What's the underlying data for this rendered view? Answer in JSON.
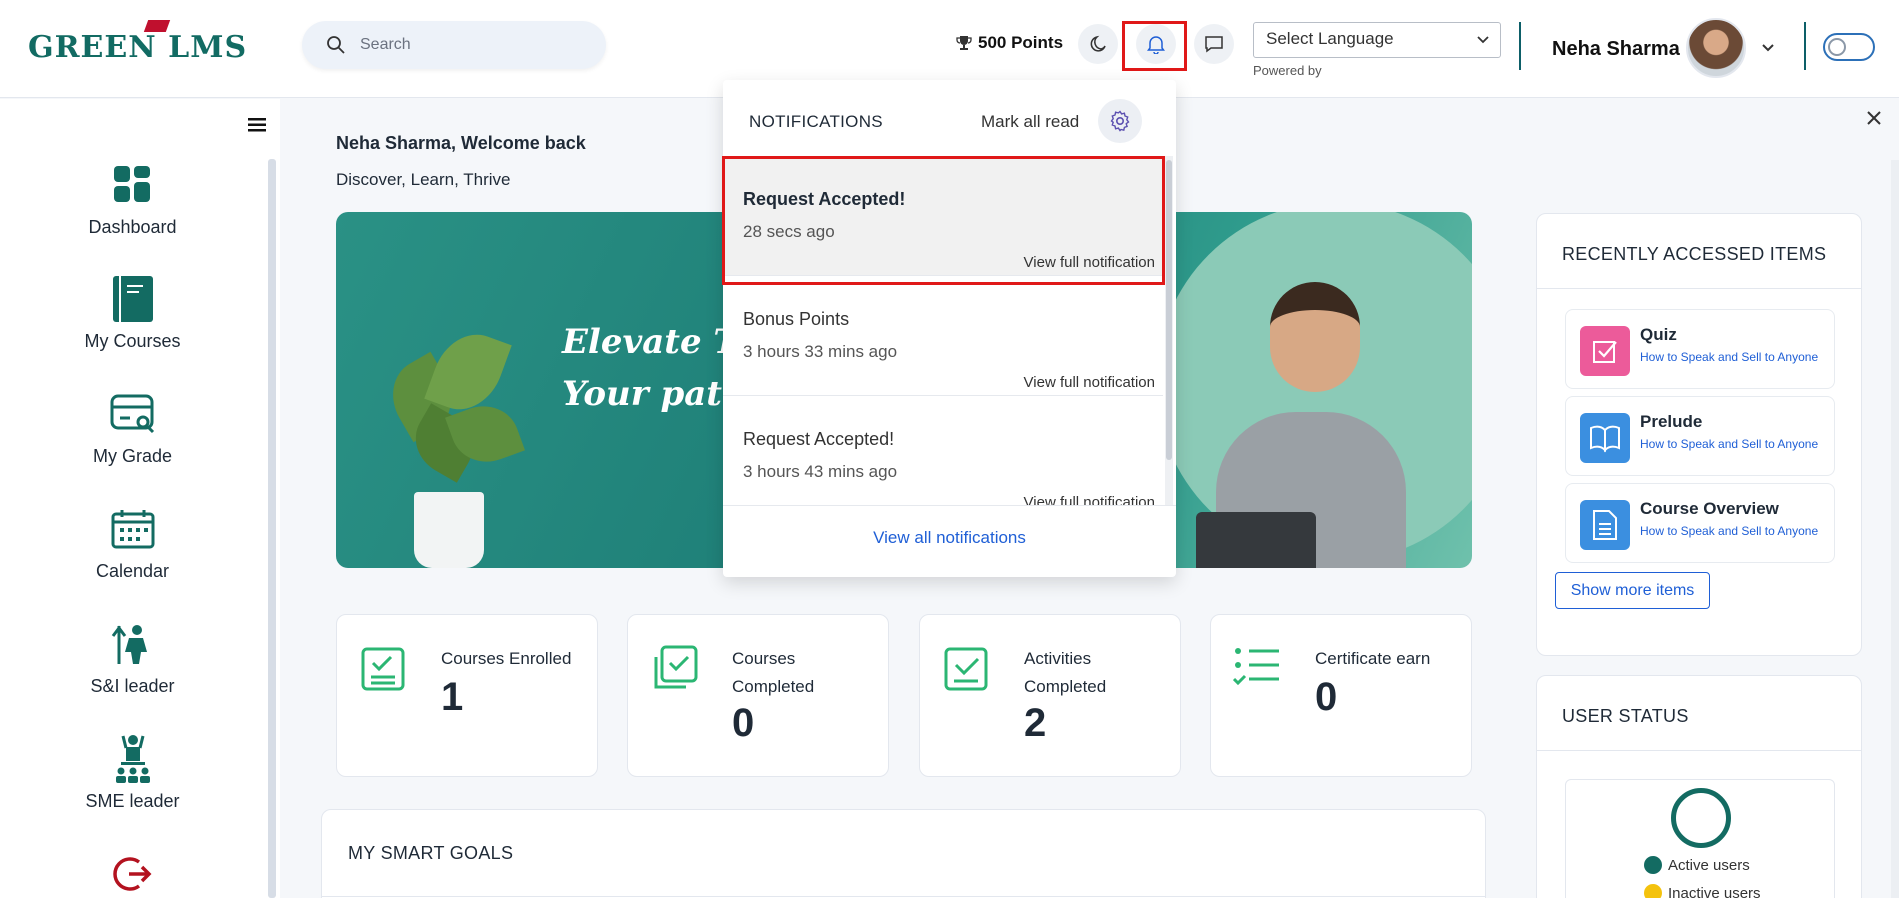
{
  "header": {
    "logo_text": "GREEN LMS",
    "search_placeholder": "Search",
    "points": "500 Points",
    "language_select": "Select Language",
    "powered_by": "Powered by",
    "user_name": "Neha Sharma"
  },
  "sidebar": {
    "items": [
      {
        "label": "Dashboard",
        "icon": "dashboard-icon"
      },
      {
        "label": "My Courses",
        "icon": "book-icon"
      },
      {
        "label": "My Grade",
        "icon": "grade-icon"
      },
      {
        "label": "Calendar",
        "icon": "calendar-icon"
      },
      {
        "label": "S&I leader",
        "icon": "leader-icon"
      },
      {
        "label": "SME leader",
        "icon": "presenter-icon"
      }
    ]
  },
  "main": {
    "welcome": "Neha Sharma, Welcome back",
    "tagline": "Discover, Learn, Thrive",
    "hero_line1": "Elevate Tal",
    "hero_line2": "Your pathu",
    "stats": [
      {
        "label": "Courses Enrolled",
        "value": "1"
      },
      {
        "label": "Courses Completed",
        "value": "0"
      },
      {
        "label": "Activities Completed",
        "value": "2"
      },
      {
        "label": "Certificate earn",
        "value": "0"
      }
    ],
    "goals_title": "MY SMART GOALS"
  },
  "recent": {
    "title": "RECENTLY ACCESSED ITEMS",
    "items": [
      {
        "title": "Quiz",
        "subtitle": "How to Speak and Sell to Anyone",
        "color": "#ec5b9a"
      },
      {
        "title": "Prelude",
        "subtitle": "How to Speak and Sell to Anyone",
        "color": "#3b8fe0"
      },
      {
        "title": "Course Overview",
        "subtitle": "How to Speak and Sell to Anyone",
        "color": "#3b8fe0"
      }
    ],
    "show_more": "Show more items"
  },
  "user_status": {
    "title": "USER STATUS",
    "legend": [
      {
        "label": "Active users",
        "color": "#136b62"
      },
      {
        "label": "Inactive users",
        "color": "#f4c20d"
      }
    ]
  },
  "notifications": {
    "title": "NOTIFICATIONS",
    "mark_all_read": "Mark all read",
    "items": [
      {
        "title": "Request Accepted!",
        "time": "28 secs ago",
        "link": "View full notification",
        "unread": true
      },
      {
        "title": "Bonus Points",
        "time": "3 hours 33 mins ago",
        "link": "View full notification",
        "unread": false
      },
      {
        "title": "Request Accepted!",
        "time": "3 hours 43 mins ago",
        "link": "View full notification",
        "unread": false
      }
    ],
    "view_all": "View all notifications"
  },
  "colors": {
    "brand": "#126b63",
    "link": "#1f5fd6",
    "highlight": "#e01818",
    "stat_icon": "#2bb673"
  }
}
